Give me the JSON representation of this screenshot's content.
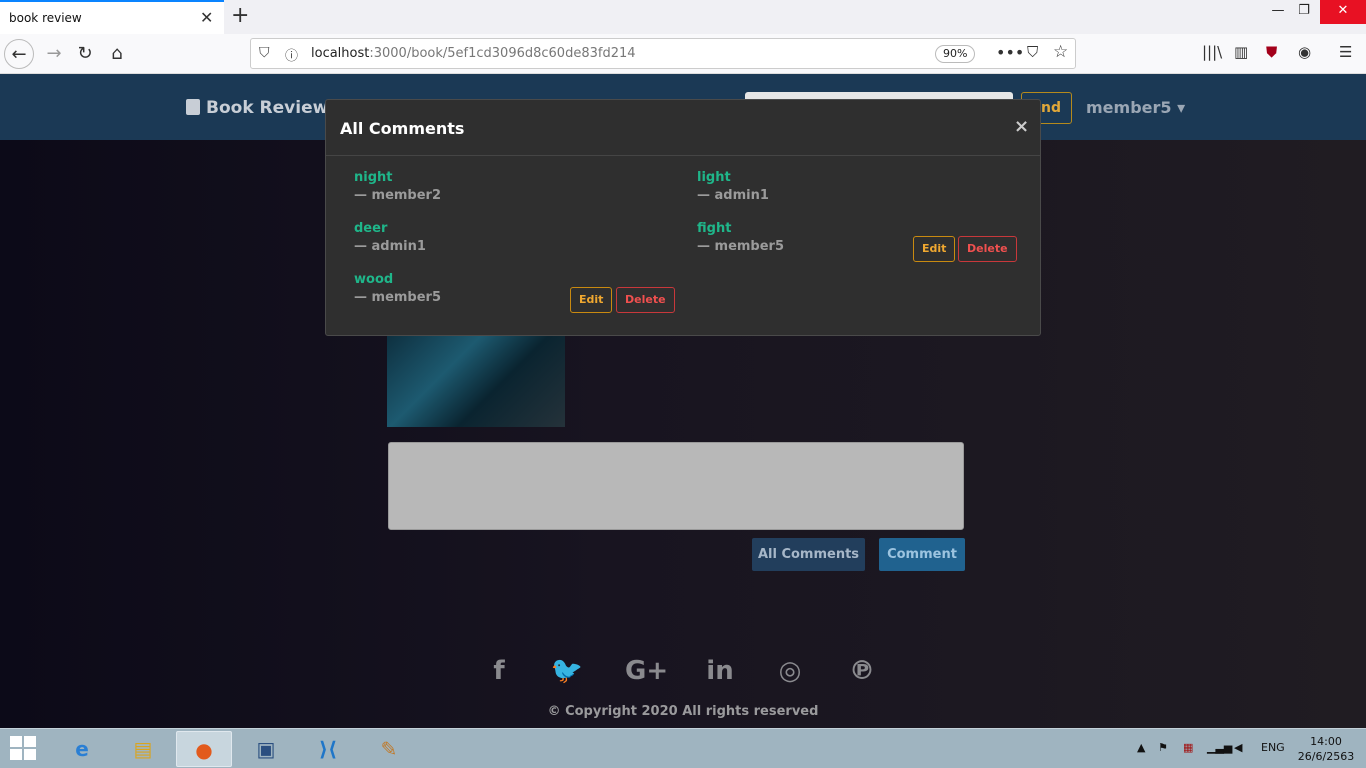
{
  "browser": {
    "tab_title": "book review",
    "tab_close": "✕",
    "new_tab": "+",
    "url_host": "localhost",
    "url_rest": ":3000/book/5ef1cd3096d8c60de83fd214",
    "zoom": "90%",
    "window_controls": {
      "minimize": "—",
      "maximize": "❐",
      "close": "✕"
    }
  },
  "site": {
    "brand": "Book Review",
    "find_label": "Find",
    "user": "member5 ▾"
  },
  "modal": {
    "title": "All Comments",
    "close": "×",
    "comments": [
      {
        "text": "night",
        "author": "— member2"
      },
      {
        "text": "light",
        "author": "— admin1"
      },
      {
        "text": "deer",
        "author": "— admin1"
      },
      {
        "text": "fight",
        "author": "— member5",
        "edit": "Edit",
        "delete": "Delete"
      },
      {
        "text": "wood",
        "author": "— member5",
        "edit": "Edit",
        "delete": "Delete"
      }
    ]
  },
  "actions": {
    "all_comments": "All Comments",
    "comment": "Comment"
  },
  "footer": {
    "social": [
      "f",
      "🐦",
      "G+",
      "in",
      "◎",
      "℗"
    ],
    "social_names": [
      "facebook-icon",
      "twitter-icon",
      "google-plus-icon",
      "linkedin-icon",
      "instagram-icon",
      "pinterest-icon"
    ],
    "copyright": "© Copyright 2020 All rights reserved"
  },
  "taskbar": {
    "lang": "ENG",
    "time": "14:00",
    "date": "26/6/2563"
  },
  "colors": {
    "accent_green": "#1fb68a",
    "edit_orange": "#f0a830",
    "delete_red": "#f0504f",
    "site_nav": "#1b3955"
  }
}
